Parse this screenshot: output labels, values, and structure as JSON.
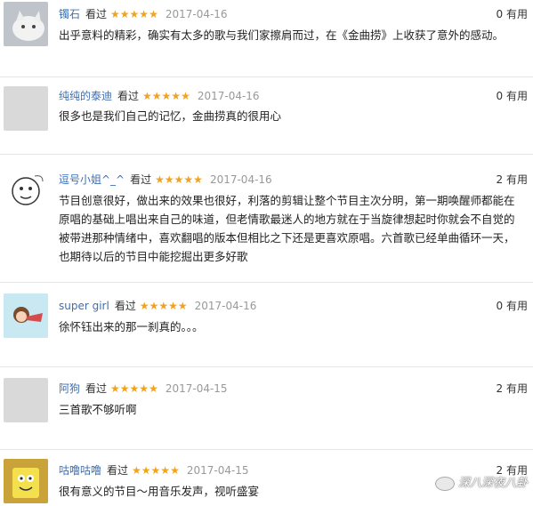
{
  "reviews": [
    {
      "user": "镯石",
      "action": "看过",
      "stars": "★★★★★",
      "date": "2017-04-16",
      "useful": "0 有用",
      "text": "出乎意料的精彩，确实有太多的歌与我们家擦肩而过，在《金曲捞》上收获了意外的感动。"
    },
    {
      "user": "纯纯的泰迪",
      "action": "看过",
      "stars": "★★★★★",
      "date": "2017-04-16",
      "useful": "0 有用",
      "text": "很多也是我们自己的记忆，金曲捞真的很用心"
    },
    {
      "user": "逗号小姐^_^",
      "action": "看过",
      "stars": "★★★★★",
      "date": "2017-04-16",
      "useful": "2 有用",
      "text": "节目创意很好，做出来的效果也很好，利落的剪辑让整个节目主次分明，第一期唤醒师都能在原唱的基础上唱出来自己的味道，但老情歌最迷人的地方就在于当旋律想起时你就会不自觉的被带进那种情绪中，喜欢翻唱的版本但相比之下还是更喜欢原唱。六首歌已经单曲循环一天，也期待以后的节目中能挖掘出更多好歌"
    },
    {
      "user": "super girl",
      "action": "看过",
      "stars": "★★★★★",
      "date": "2017-04-16",
      "useful": "0 有用",
      "text": "徐怀钰出来的那一刹真的。。。"
    },
    {
      "user": "阿狗",
      "action": "看过",
      "stars": "★★★★★",
      "date": "2017-04-15",
      "useful": "2 有用",
      "text": "三首歌不够听啊"
    },
    {
      "user": "咕噜咕噜",
      "action": "看过",
      "stars": "★★★★★",
      "date": "2017-04-15",
      "useful": "2 有用",
      "text": "很有意义的节目～用音乐发声，视听盛宴"
    }
  ],
  "watermark": "深八深夜八卦"
}
